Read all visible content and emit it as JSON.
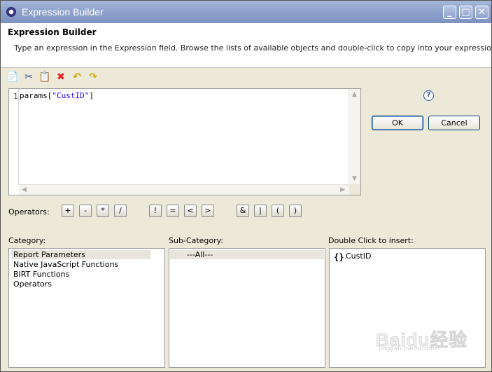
{
  "window": {
    "title": "Expression Builder"
  },
  "header": {
    "title": "Expression Builder",
    "description": "Type an expression in the Expression field. Browse the lists of available objects and double-click to copy into your expression."
  },
  "toolbar": {
    "icons": [
      "copy-icon",
      "cut-icon",
      "paste-icon",
      "delete-icon",
      "undo-icon",
      "redo-icon"
    ]
  },
  "editor": {
    "line_number": "1",
    "code_prefix": "params[",
    "code_string": "\"CustID\"",
    "code_suffix": "]"
  },
  "buttons": {
    "ok": "OK",
    "cancel": "Cancel",
    "help": "?"
  },
  "operators": {
    "label": "Operators:",
    "items": [
      "+",
      "-",
      "*",
      "/",
      "!",
      "=",
      "<",
      ">",
      "&",
      "|",
      "(",
      ")"
    ]
  },
  "category": {
    "label": "Category:",
    "items": [
      "Report Parameters",
      "Native JavaScript Functions",
      "BIRT Functions",
      "Operators"
    ],
    "selected": "Report Parameters"
  },
  "subcategory": {
    "label": "Sub-Category:",
    "items": [
      "---All---"
    ]
  },
  "insert": {
    "label": "Double Click to insert:",
    "items": [
      "CustID"
    ]
  },
  "watermark": {
    "text": "Baidu经验",
    "sub": "jingyan.baidu.com"
  }
}
